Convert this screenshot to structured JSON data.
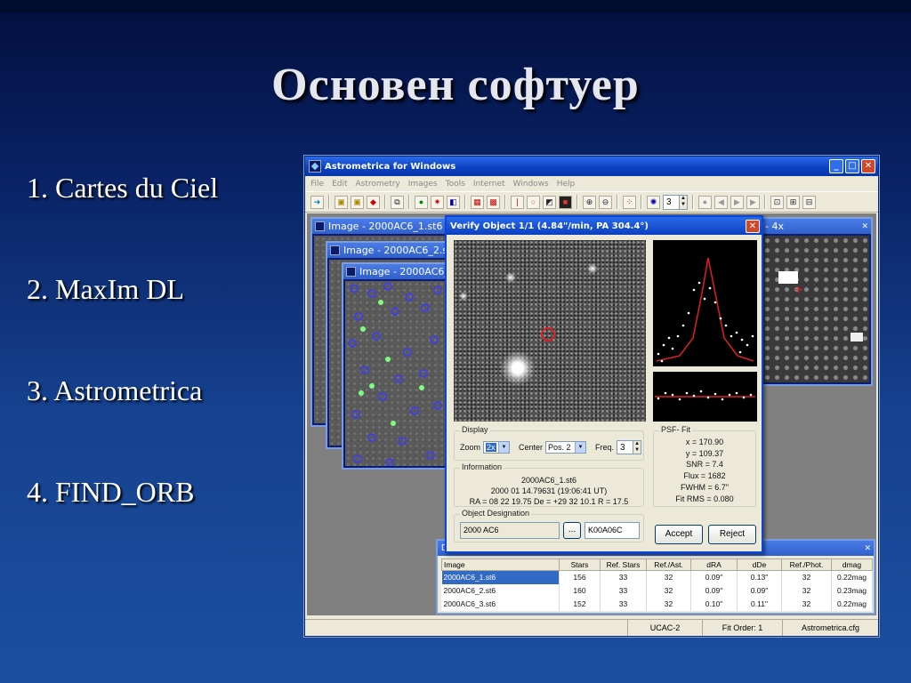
{
  "slide": {
    "title": "Основен софтуер",
    "bullets": [
      "1. Cartes du Ciel",
      "2. MaxIm DL",
      "3. Astrometrica",
      "4. FIND_ORB"
    ]
  },
  "app": {
    "title": "Astrometrica for Windows",
    "menu": [
      "File",
      "Edit",
      "Astrometry",
      "Images",
      "Tools",
      "Internet",
      "Windows",
      "Help"
    ],
    "toolbar_spin": "3",
    "images": [
      "Image - 2000AC6_1.st6",
      "Image - 2000AC6_2.st",
      "Image - 2000AC6_"
    ],
    "right_window_title": "- 4x",
    "status": [
      "UCAC-2",
      "Fit Order: 1",
      "Astrometrica.cfg"
    ]
  },
  "dialog": {
    "title": "Verify Object 1/1 (4.84\"/min, PA 304.4°)",
    "display": {
      "label": "Display",
      "zoom_label": "Zoom",
      "zoom_value": "2x",
      "center_label": "Center",
      "center_value": "Pos. 2",
      "freq_label": "Freq.",
      "freq_value": "3"
    },
    "info": {
      "label": "Information",
      "line1": "2000AC6_1.st6",
      "line2": "2000 01 14.79631 (19:06:41 UT)",
      "line3": "RA = 08 22 19.75   De = +29 32 10.1   R = 17.5"
    },
    "psf": {
      "label": "PSF- Fit",
      "lines": [
        "x = 170.90",
        "y = 109.37",
        "SNR = 7.4",
        "Flux = 1682",
        "FWHM = 6.7\"",
        "Fit RMS = 0.080"
      ]
    },
    "desig": {
      "label": "Object Designation",
      "value": "2000 AC6",
      "browse": "...",
      "code": "K00A06C"
    },
    "accept": "Accept",
    "reject": "Reject"
  },
  "table": {
    "title": "D",
    "headers": [
      "Image",
      "Stars",
      "Ref. Stars",
      "Ref./Ast.",
      "dRA",
      "dDe",
      "Ref./Phot.",
      "dmag"
    ],
    "rows": [
      [
        "2000AC6_1.st6",
        "156",
        "33",
        "32",
        "0.09\"",
        "0.13\"",
        "32",
        "0.22mag"
      ],
      [
        "2000AC6_2.st6",
        "160",
        "33",
        "32",
        "0.09\"",
        "0.09\"",
        "32",
        "0.23mag"
      ],
      [
        "2000AC6_3.st6",
        "152",
        "33",
        "32",
        "0.10\"",
        "0.11\"",
        "32",
        "0.22mag"
      ]
    ]
  },
  "colors": {
    "slide_bg": "#15418f",
    "titlebar": "#0a3fc0",
    "selection": "#316ac5",
    "psf_curve": "#e02020"
  }
}
